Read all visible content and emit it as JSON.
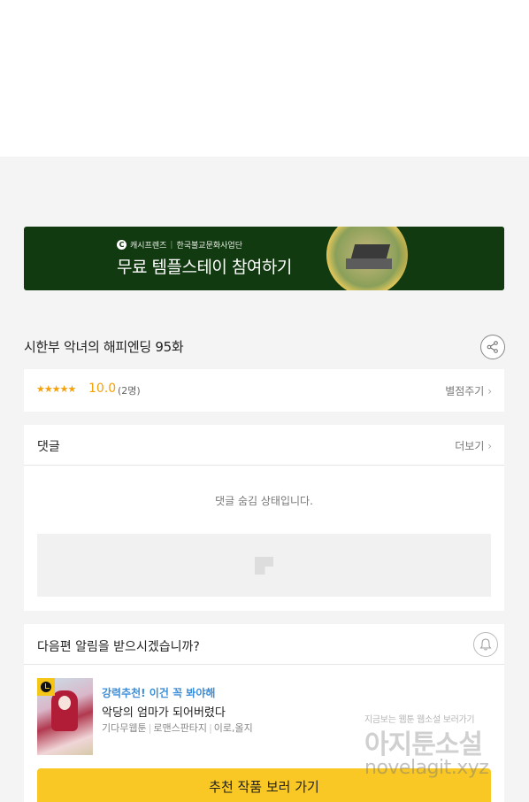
{
  "banner": {
    "brand_logo_letter": "C",
    "brand_name": "캐시프렌즈",
    "sponsor": "한국불교문화사업단",
    "headline": "무료 템플스테이 참여하기"
  },
  "episode": {
    "title": "시한부 악녀의 해피엔딩 95화"
  },
  "rating": {
    "stars": "★★★★★",
    "score": "10.0",
    "count": "(2명)",
    "rate_link": "별점주기"
  },
  "comments": {
    "title": "댓글",
    "more_link": "더보기",
    "hidden_message": "댓글 숨김 상태입니다."
  },
  "notify": {
    "title": "다음편 알림을 받으시겠습니까?",
    "recommend": {
      "tag": "강력추천! 이건 꼭 봐야해",
      "title": "악당의 엄마가 되어버렸다",
      "meta_type": "기다무웹툰",
      "meta_genre": "로맨스판타지",
      "meta_authors": "이로,올지"
    },
    "cta_label": "추천 작품 보러 가기"
  },
  "watermark": {
    "line1": "지금보는 웹툰 웹소설 보러가기",
    "line2": "아지툰소설",
    "line3": "novelagit.xyz"
  },
  "colors": {
    "banner_bg": "#123a10",
    "rating_accent": "#f4a10c",
    "recommend_tag": "#3d8ed8",
    "cta_bg": "#f9c825"
  }
}
